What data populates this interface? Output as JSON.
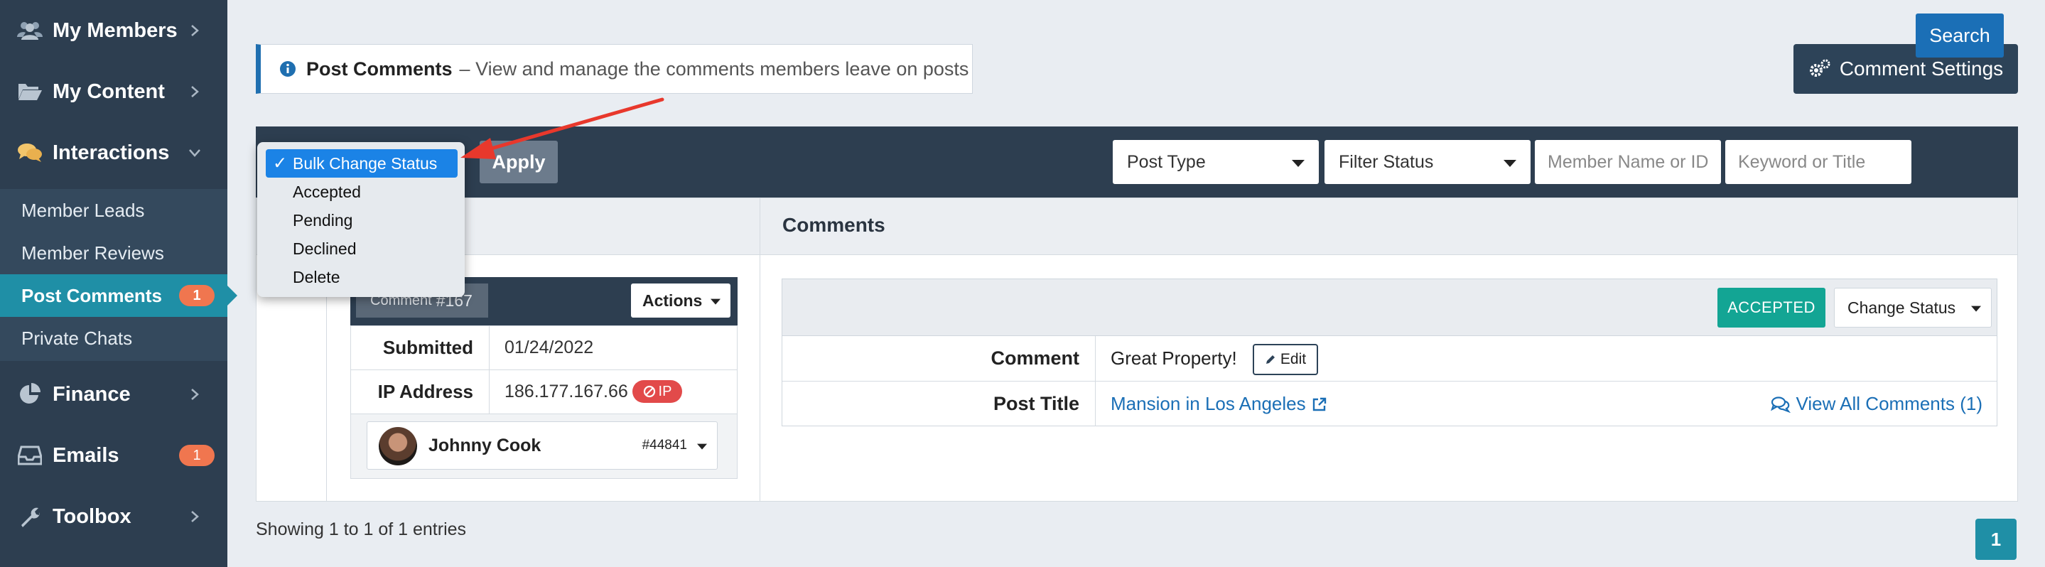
{
  "sidebar": {
    "main_items": [
      {
        "label": "My Members",
        "icon": "users-icon"
      },
      {
        "label": "My Content",
        "icon": "folder-open-icon"
      },
      {
        "label": "Interactions",
        "icon": "comments-icon"
      },
      {
        "label": "Finance",
        "icon": "pie-chart-icon"
      },
      {
        "label": "Emails",
        "icon": "inbox-icon",
        "badge": "1"
      },
      {
        "label": "Toolbox",
        "icon": "wrench-icon"
      }
    ],
    "sub_items": [
      {
        "label": "Member Leads"
      },
      {
        "label": "Member Reviews"
      },
      {
        "label": "Post Comments",
        "badge": "1",
        "active": true
      },
      {
        "label": "Private Chats"
      }
    ]
  },
  "info": {
    "title": "Post Comments",
    "description": "– View and manage the comments members leave on posts"
  },
  "settings_button": "Comment Settings",
  "toolbar": {
    "bulk_options": [
      "Bulk Change Status",
      "Accepted",
      "Pending",
      "Declined",
      "Delete"
    ],
    "selected_bulk": "Bulk Change Status",
    "apply_label": "Apply",
    "post_type": "Post Type",
    "filter_status": "Filter Status",
    "member_placeholder": "Member Name or ID",
    "keyword_placeholder": "Keyword or Title",
    "search_label": "Search"
  },
  "table": {
    "comments_header": "Comments",
    "comment_tag_prefix": "Comment",
    "comment_id": "#167",
    "actions_label": "Actions",
    "submitted_label": "Submitted",
    "submitted_value": "01/24/2022",
    "ip_label": "IP Address",
    "ip_value": "186.177.167.66",
    "ip_badge": "IP",
    "member_name": "Johnny Cook",
    "member_id": "#44841",
    "status": "ACCEPTED",
    "change_status_label": "Change Status",
    "comment_label": "Comment",
    "comment_value": "Great Property!",
    "edit_label": "Edit",
    "post_title_label": "Post Title",
    "post_title_value": "Mansion in Los Angeles",
    "view_all_label": "View All Comments (1)"
  },
  "footer": {
    "showing": "Showing 1 to 1 of 1 entries",
    "page": "1"
  },
  "colors": {
    "sidebar": "#2d3e50",
    "active": "#1f8fa6",
    "accent_blue": "#1b6fb6",
    "accepted": "#13a594",
    "badge": "#f0764f",
    "arrow": "#e8382c"
  }
}
